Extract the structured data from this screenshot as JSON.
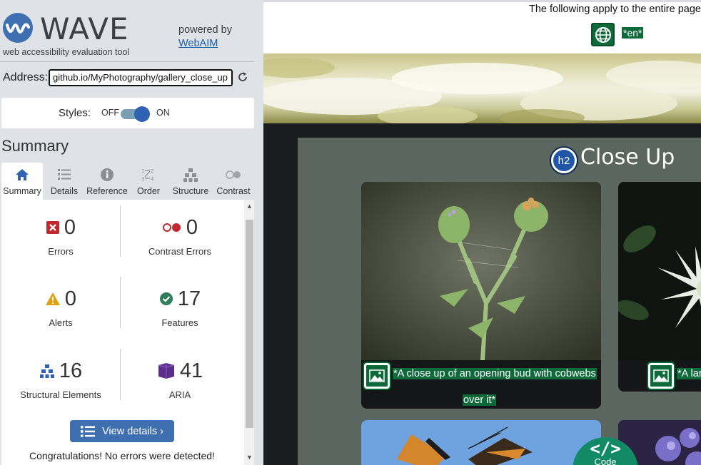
{
  "wave": {
    "title": "WAVE",
    "subtitle": "web accessibility evaluation tool",
    "powered_by": "powered by",
    "webaim_link": "WebAIM",
    "address_label": "Address:",
    "address_value": "github.io/MyPhotography/gallery_close_up",
    "styles_label": "Styles:",
    "styles_off": "OFF",
    "styles_on": "ON",
    "styles_enabled": true,
    "summary_heading": "Summary",
    "tabs": [
      {
        "label": "Summary",
        "icon": "home-icon",
        "active": true
      },
      {
        "label": "Details",
        "icon": "list-icon",
        "active": false
      },
      {
        "label": "Reference",
        "icon": "info-icon",
        "active": false
      },
      {
        "label": "Order",
        "icon": "order-icon",
        "active": false
      },
      {
        "label": "Structure",
        "icon": "structure-icon",
        "active": false
      },
      {
        "label": "Contrast",
        "icon": "contrast-icon",
        "active": false
      }
    ],
    "stats": {
      "errors": {
        "value": "0",
        "label": "Errors",
        "icon": "error-x-icon"
      },
      "contrast_errors": {
        "value": "0",
        "label": "Contrast Errors",
        "icon": "contrast-error-icon"
      },
      "alerts": {
        "value": "0",
        "label": "Alerts",
        "icon": "alert-triangle-icon"
      },
      "features": {
        "value": "17",
        "label": "Features",
        "icon": "feature-check-icon"
      },
      "structural": {
        "value": "16",
        "label": "Structural Elements",
        "icon": "structure-icon"
      },
      "aria": {
        "value": "41",
        "label": "ARIA",
        "icon": "aria-cube-icon"
      }
    },
    "view_details": "View details ›",
    "congrats": "Congratulations! No errors were detected!"
  },
  "page": {
    "notice": "The following apply to the entire page",
    "lang_badge": "*en*",
    "h2_badge": "h2",
    "gallery_title": "Close Up",
    "captions": [
      "*A close up of an opening bud with cobwebs",
      "over it*",
      "*A lar"
    ],
    "code_button": "Code",
    "code_glyph": "</>"
  },
  "colors": {
    "wave_sidebar_bg": "#dfe3e8",
    "wave_blue": "#3e6fb0",
    "feature_green": "#0e6a3a",
    "error_red": "#c1272d",
    "alert_orange": "#e0a010",
    "aria_purple": "#5b2e8c",
    "panel_bg": "#5b6660",
    "code_teal": "#128a66"
  }
}
